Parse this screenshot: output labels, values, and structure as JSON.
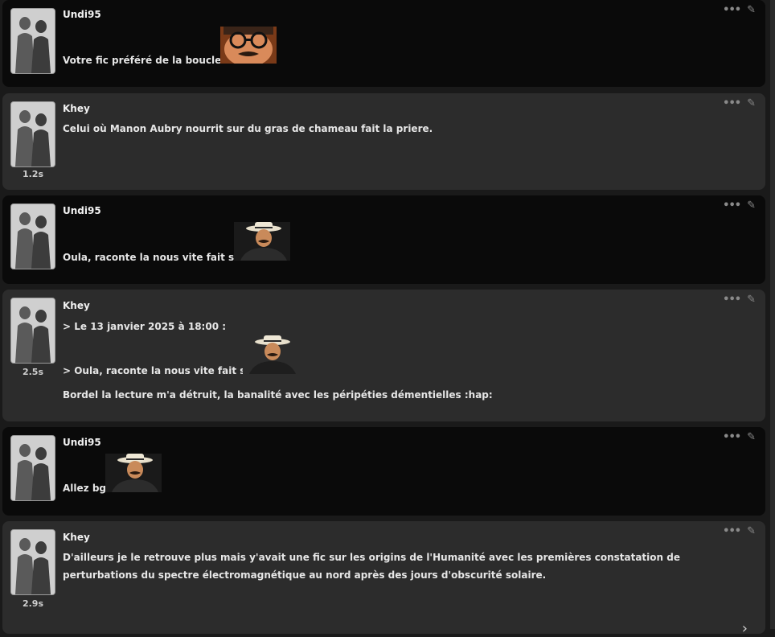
{
  "messages": [
    {
      "author": "Undi95",
      "time": "",
      "lines": [
        "Votre fic préféré de la boucle ?"
      ],
      "sticker": "glasses-man-sticker"
    },
    {
      "author": "Khey",
      "time": "1.2s",
      "lines": [
        "Celui où Manon Aubry nourrit sur du gras de chameau fait la priere."
      ]
    },
    {
      "author": "Undi95",
      "time": "",
      "lines": [
        "Oula, raconte la nous vite fait stv"
      ],
      "sticker": "hat-man-sticker"
    },
    {
      "author": "Khey",
      "time": "2.5s",
      "quote_header": "> Le 13 janvier 2025 à 18:00 :",
      "quote_line": "> Oula, raconte la nous vite fait stv",
      "lines": [
        "Bordel la lecture m'a détruit, la banalité avec les péripéties démentielles :hap:"
      ],
      "sticker": "hat-man-sticker"
    },
    {
      "author": "Undi95",
      "time": "",
      "lines": [
        "Allez bg"
      ],
      "sticker": "hat-man-sticker"
    },
    {
      "author": "Khey",
      "time": "2.9s",
      "lines": [
        "D'ailleurs je le retrouve plus mais y'avait une fic sur les origins de l'Humanité avec les premières constatation de perturbations du spectre électromagnétique au nord après des jours d'obscurité solaire."
      ]
    }
  ],
  "icons": {
    "more": "more-dots-icon",
    "edit": "pencil-icon",
    "scroll": "chevron-right-icon"
  },
  "colors": {
    "dark_bubble": "#0a0a0a",
    "light_bubble": "#2c2c2c",
    "text": "#e6e6e6",
    "muted": "#8a8a8a"
  }
}
